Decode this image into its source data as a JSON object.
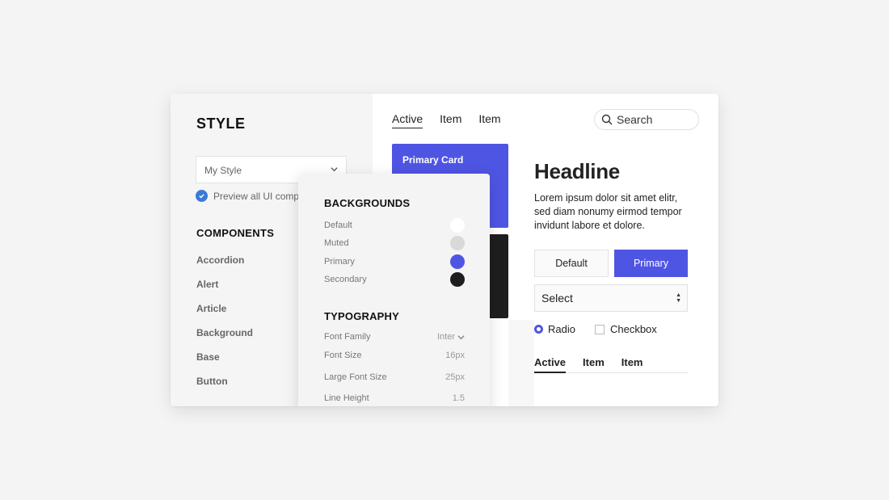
{
  "sidebar": {
    "title": "STYLE",
    "style_select": {
      "value": "My Style"
    },
    "preview_label": "Preview all UI components",
    "components_title": "COMPONENTS",
    "components": [
      "Accordion",
      "Alert",
      "Article",
      "Background",
      "Base",
      "Button"
    ]
  },
  "header": {
    "tabs": [
      {
        "label": "Active",
        "active": true
      },
      {
        "label": "Item",
        "active": false
      },
      {
        "label": "Item",
        "active": false
      }
    ],
    "search": {
      "placeholder": "Search"
    }
  },
  "cards": {
    "primary_title": "Primary Card"
  },
  "content": {
    "headline": "Headline",
    "lorem": "Lorem ipsum dolor sit amet elitr, sed diam nonumy eirmod tempor invidunt labore et dolore.",
    "default_button": "Default",
    "primary_button": "Primary",
    "select_value": "Select",
    "radio_label": "Radio",
    "checkbox_label": "Checkbox",
    "tabs": [
      {
        "label": "Active",
        "active": true
      },
      {
        "label": "Item",
        "active": false
      },
      {
        "label": "Item",
        "active": false
      }
    ]
  },
  "style_panel": {
    "backgrounds_title": "BACKGROUNDS",
    "backgrounds": [
      {
        "label": "Default",
        "color": "#ffffff"
      },
      {
        "label": "Muted",
        "color": "#d9d9d9"
      },
      {
        "label": "Primary",
        "color": "#4f55e3"
      },
      {
        "label": "Secondary",
        "color": "#1e1e1e"
      }
    ],
    "typography_title": "TYPOGRAPHY",
    "typography": [
      {
        "label": "Font Family",
        "value": "Inter"
      },
      {
        "label": "Font Size",
        "value": "16px"
      },
      {
        "label": "Large Font Size",
        "value": "25px"
      },
      {
        "label": "Line Height",
        "value": "1.5"
      }
    ]
  },
  "colors": {
    "primary": "#4f55e3",
    "secondary": "#1e1e1e",
    "check_blue": "#3a7bd5"
  }
}
